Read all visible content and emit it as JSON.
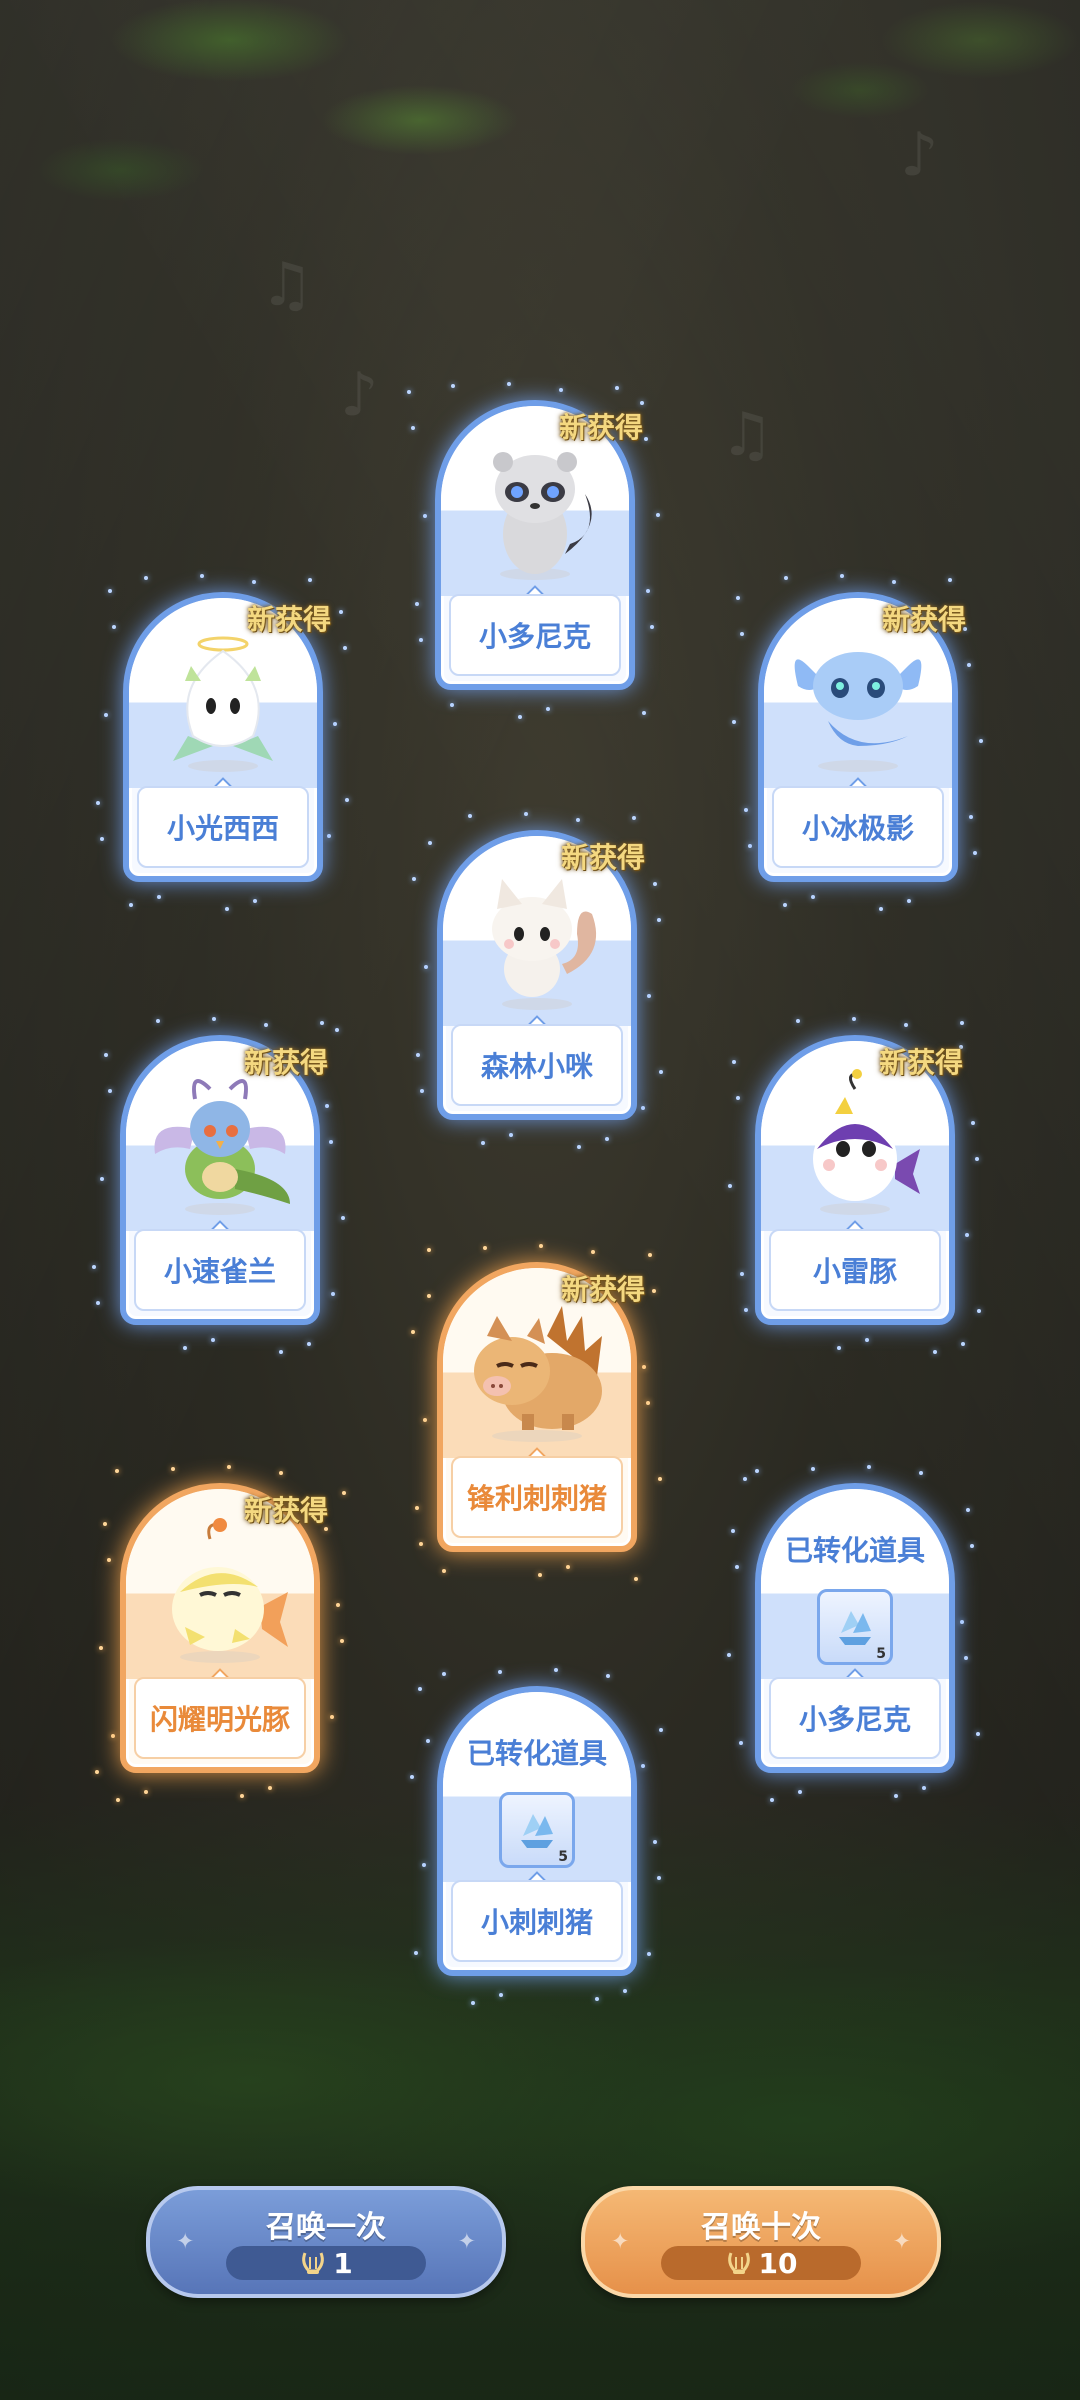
{
  "new_label": "新获得",
  "converted_label": "已转化道具",
  "cards": [
    {
      "id": "c1",
      "name": "小多尼克",
      "new": true,
      "rarity": "blue",
      "creature": "raccoon-creature"
    },
    {
      "id": "c2",
      "name": "小光西西",
      "new": true,
      "rarity": "blue",
      "creature": "light-sprite-creature"
    },
    {
      "id": "c3",
      "name": "小冰极影",
      "new": true,
      "rarity": "blue",
      "creature": "ice-axolotl-creature"
    },
    {
      "id": "c4",
      "name": "森林小咪",
      "new": true,
      "rarity": "blue",
      "creature": "forest-cat-creature"
    },
    {
      "id": "c5",
      "name": "小速雀兰",
      "new": true,
      "rarity": "blue",
      "creature": "bird-creature"
    },
    {
      "id": "c6",
      "name": "小雷豚",
      "new": true,
      "rarity": "blue",
      "creature": "thunder-puffer-creature"
    },
    {
      "id": "c7",
      "name": "锋利刺刺猪",
      "new": true,
      "rarity": "gold",
      "creature": "spiky-boar-creature"
    },
    {
      "id": "c8",
      "name": "闪耀明光豚",
      "new": true,
      "rarity": "gold",
      "creature": "shining-puffer-creature"
    },
    {
      "id": "c9",
      "name": "小多尼克",
      "new": false,
      "rarity": "blue",
      "converted": true,
      "item_count": "5",
      "item": "crystal-icon"
    },
    {
      "id": "c10",
      "name": "小刺刺猪",
      "new": false,
      "rarity": "blue",
      "converted": true,
      "item_count": "5",
      "item": "crystal-icon"
    }
  ],
  "buttons": {
    "summon_once": {
      "label": "召唤一次",
      "cost": "1",
      "color": "#5e7cc0"
    },
    "summon_ten": {
      "label": "召唤十次",
      "cost": "10",
      "color": "#ec9c52"
    }
  },
  "colors": {
    "blue_frame": "#6f9ee8",
    "gold_frame": "#f1a660",
    "new_text": "#f4d880"
  }
}
